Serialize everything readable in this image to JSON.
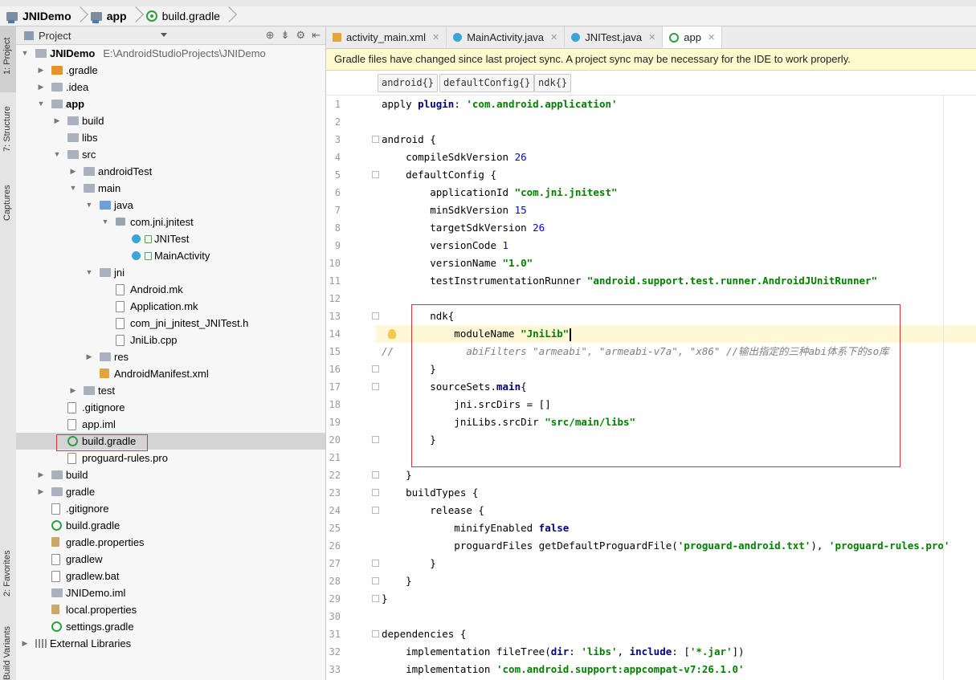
{
  "breadcrumb": {
    "items": [
      "JNIDemo",
      "app",
      "build.gradle"
    ]
  },
  "left_tool_tabs": [
    "1: Project",
    "7: Structure",
    "Captures",
    "2: Favorites",
    "Build Variants"
  ],
  "project_panel": {
    "title": "Project",
    "tools": [
      "⊕",
      "⇟",
      "⚙",
      "⇤"
    ],
    "root_path": "E:\\AndroidStudioProjects\\JNIDemo",
    "tree": [
      {
        "label": "JNIDemo",
        "depth": 0,
        "icon": "module-folder",
        "expanded": true,
        "bold": true
      },
      {
        "label": ".gradle",
        "depth": 1,
        "icon": "folder-orange",
        "expanded": false
      },
      {
        "label": ".idea",
        "depth": 1,
        "icon": "folder",
        "expanded": false
      },
      {
        "label": "app",
        "depth": 1,
        "icon": "module-folder",
        "expanded": true,
        "bold": true
      },
      {
        "label": "build",
        "depth": 2,
        "icon": "folder",
        "expanded": false
      },
      {
        "label": "libs",
        "depth": 2,
        "icon": "folder",
        "expanded": null
      },
      {
        "label": "src",
        "depth": 2,
        "icon": "folder",
        "expanded": true
      },
      {
        "label": "androidTest",
        "depth": 3,
        "icon": "folder",
        "expanded": false
      },
      {
        "label": "main",
        "depth": 3,
        "icon": "folder",
        "expanded": true
      },
      {
        "label": "java",
        "depth": 4,
        "icon": "folder-blue",
        "expanded": true
      },
      {
        "label": "com.jni.jnitest",
        "depth": 5,
        "icon": "package",
        "expanded": true
      },
      {
        "label": "JNITest",
        "depth": 6,
        "icon": "java-class",
        "expanded": null
      },
      {
        "label": "MainActivity",
        "depth": 6,
        "icon": "java-class",
        "expanded": null
      },
      {
        "label": "jni",
        "depth": 4,
        "icon": "folder",
        "expanded": true
      },
      {
        "label": "Android.mk",
        "depth": 5,
        "icon": "file",
        "expanded": null
      },
      {
        "label": "Application.mk",
        "depth": 5,
        "icon": "file",
        "expanded": null
      },
      {
        "label": "com_jni_jnitest_JNITest.h",
        "depth": 5,
        "icon": "file",
        "expanded": null
      },
      {
        "label": "JniLib.cpp",
        "depth": 5,
        "icon": "file",
        "expanded": null
      },
      {
        "label": "res",
        "depth": 4,
        "icon": "folder",
        "expanded": false
      },
      {
        "label": "AndroidManifest.xml",
        "depth": 4,
        "icon": "xml",
        "expanded": null
      },
      {
        "label": "test",
        "depth": 3,
        "icon": "folder",
        "expanded": false
      },
      {
        "label": ".gitignore",
        "depth": 2,
        "icon": "file",
        "expanded": null
      },
      {
        "label": "app.iml",
        "depth": 2,
        "icon": "file",
        "expanded": null
      },
      {
        "label": "build.gradle",
        "depth": 2,
        "icon": "gradle",
        "expanded": null,
        "selected": true
      },
      {
        "label": "proguard-rules.pro",
        "depth": 2,
        "icon": "file",
        "expanded": null
      },
      {
        "label": "build",
        "depth": 1,
        "icon": "folder",
        "expanded": false
      },
      {
        "label": "gradle",
        "depth": 1,
        "icon": "folder",
        "expanded": false
      },
      {
        "label": ".gitignore",
        "depth": 1,
        "icon": "file",
        "expanded": null
      },
      {
        "label": "build.gradle",
        "depth": 1,
        "icon": "gradle",
        "expanded": null
      },
      {
        "label": "gradle.properties",
        "depth": 1,
        "icon": "props",
        "expanded": null
      },
      {
        "label": "gradlew",
        "depth": 1,
        "icon": "file",
        "expanded": null
      },
      {
        "label": "gradlew.bat",
        "depth": 1,
        "icon": "file",
        "expanded": null
      },
      {
        "label": "JNIDemo.iml",
        "depth": 1,
        "icon": "module-folder",
        "expanded": null
      },
      {
        "label": "local.properties",
        "depth": 1,
        "icon": "props",
        "expanded": null
      },
      {
        "label": "settings.gradle",
        "depth": 1,
        "icon": "gradle",
        "expanded": null
      },
      {
        "label": "External Libraries",
        "depth": 0,
        "icon": "library",
        "expanded": false
      }
    ]
  },
  "editor": {
    "tabs": [
      {
        "label": "activity_main.xml",
        "icon": "xml",
        "active": false
      },
      {
        "label": "MainActivity.java",
        "icon": "java",
        "active": false
      },
      {
        "label": "JNITest.java",
        "icon": "java",
        "active": false
      },
      {
        "label": "app",
        "icon": "gradle",
        "active": true
      }
    ],
    "tab_close": "✕",
    "notice": "Gradle files have changed since last project sync. A project sync may be necessary for the IDE to work properly.",
    "scope_chips": [
      "android{}",
      "defaultConfig{}",
      "ndk{}"
    ],
    "lines": [
      {
        "n": 1,
        "parts": [
          [
            "p",
            "apply "
          ],
          [
            "kw",
            "plugin"
          ],
          [
            "p",
            ": "
          ],
          [
            "str",
            "'com.android.application'"
          ]
        ]
      },
      {
        "n": 2,
        "parts": []
      },
      {
        "n": 3,
        "parts": [
          [
            "p",
            "android {"
          ]
        ]
      },
      {
        "n": 4,
        "parts": [
          [
            "p",
            "    compileSdkVersion "
          ],
          [
            "num",
            "26"
          ]
        ]
      },
      {
        "n": 5,
        "parts": [
          [
            "p",
            "    defaultConfig {"
          ]
        ]
      },
      {
        "n": 6,
        "parts": [
          [
            "p",
            "        applicationId "
          ],
          [
            "str",
            "\"com.jni.jnitest\""
          ]
        ]
      },
      {
        "n": 7,
        "parts": [
          [
            "p",
            "        minSdkVersion "
          ],
          [
            "num",
            "15"
          ]
        ]
      },
      {
        "n": 8,
        "parts": [
          [
            "p",
            "        targetSdkVersion "
          ],
          [
            "num",
            "26"
          ]
        ]
      },
      {
        "n": 9,
        "parts": [
          [
            "p",
            "        versionCode "
          ],
          [
            "num",
            "1"
          ]
        ]
      },
      {
        "n": 10,
        "parts": [
          [
            "p",
            "        versionName "
          ],
          [
            "str",
            "\"1.0\""
          ]
        ]
      },
      {
        "n": 11,
        "parts": [
          [
            "p",
            "        testInstrumentationRunner "
          ],
          [
            "str",
            "\"android.support.test.runner.AndroidJUnitRunner\""
          ]
        ]
      },
      {
        "n": 12,
        "parts": []
      },
      {
        "n": 13,
        "parts": [
          [
            "p",
            "        ndk{"
          ]
        ]
      },
      {
        "n": 14,
        "parts": [
          [
            "p",
            "            moduleName "
          ],
          [
            "str",
            "\"JniLib\""
          ]
        ]
      },
      {
        "n": 15,
        "parts": [
          [
            "cmt",
            "//            abiFilters \"armeabi\", \"armeabi-v7a\", \"x86\" //输出指定的三种abi体系下的so库"
          ]
        ]
      },
      {
        "n": 16,
        "parts": [
          [
            "p",
            "        }"
          ]
        ]
      },
      {
        "n": 17,
        "parts": [
          [
            "p",
            "        sourceSets."
          ],
          [
            "kw",
            "main"
          ],
          [
            "p",
            "{"
          ]
        ]
      },
      {
        "n": 18,
        "parts": [
          [
            "p",
            "            jni.srcDirs = []"
          ]
        ]
      },
      {
        "n": 19,
        "parts": [
          [
            "p",
            "            jniLibs.srcDir "
          ],
          [
            "str",
            "\"src/main/libs\""
          ]
        ]
      },
      {
        "n": 20,
        "parts": [
          [
            "p",
            "        }"
          ]
        ]
      },
      {
        "n": 21,
        "parts": []
      },
      {
        "n": 22,
        "parts": [
          [
            "p",
            "    }"
          ]
        ]
      },
      {
        "n": 23,
        "parts": [
          [
            "p",
            "    buildTypes {"
          ]
        ]
      },
      {
        "n": 24,
        "parts": [
          [
            "p",
            "        release {"
          ]
        ]
      },
      {
        "n": 25,
        "parts": [
          [
            "p",
            "            minifyEnabled "
          ],
          [
            "kw",
            "false"
          ]
        ]
      },
      {
        "n": 26,
        "parts": [
          [
            "p",
            "            proguardFiles getDefaultProguardFile("
          ],
          [
            "str",
            "'proguard-android.txt'"
          ],
          [
            "p",
            "), "
          ],
          [
            "str",
            "'proguard-rules.pro'"
          ]
        ]
      },
      {
        "n": 27,
        "parts": [
          [
            "p",
            "        }"
          ]
        ]
      },
      {
        "n": 28,
        "parts": [
          [
            "p",
            "    }"
          ]
        ]
      },
      {
        "n": 29,
        "parts": [
          [
            "p",
            "}"
          ]
        ]
      },
      {
        "n": 30,
        "parts": []
      },
      {
        "n": 31,
        "parts": [
          [
            "p",
            "dependencies {"
          ]
        ]
      },
      {
        "n": 32,
        "parts": [
          [
            "p",
            "    implementation fileTree("
          ],
          [
            "kw",
            "dir"
          ],
          [
            "p",
            ": "
          ],
          [
            "str",
            "'libs'"
          ],
          [
            "p",
            ", "
          ],
          [
            "kw",
            "include"
          ],
          [
            "p",
            ": ["
          ],
          [
            "str",
            "'*.jar'"
          ],
          [
            "p",
            "])"
          ]
        ]
      },
      {
        "n": 33,
        "parts": [
          [
            "p",
            "    implementation "
          ],
          [
            "str",
            "'com.android.support:appcompat-v7:26.1.0'"
          ]
        ]
      }
    ]
  }
}
